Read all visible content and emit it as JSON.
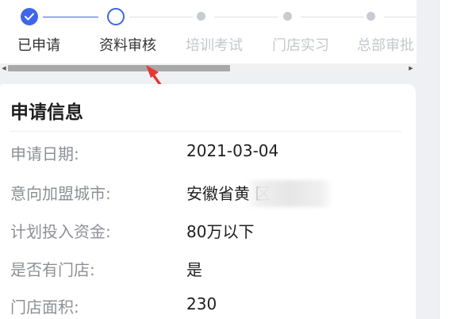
{
  "steps": [
    {
      "label": "已申请",
      "state": "done"
    },
    {
      "label": "资料审核",
      "state": "current"
    },
    {
      "label": "培训考试",
      "state": "pending"
    },
    {
      "label": "门店实习",
      "state": "pending"
    },
    {
      "label": "总部审批",
      "state": "pending"
    }
  ],
  "colors": {
    "accent": "#3f66e8",
    "muted_text": "#8e9096",
    "pointer": "#e53935"
  },
  "card": {
    "title": "申请信息",
    "rows": [
      {
        "key": "申请日期:",
        "value": "2021-03-04"
      },
      {
        "key": "意向加盟城市:",
        "value": "安徽省黄   区"
      },
      {
        "key": "计划投入资金:",
        "value": "80万以下"
      },
      {
        "key": "是否有门店:",
        "value": "是"
      },
      {
        "key": "门店面积:",
        "value": "230"
      }
    ]
  }
}
